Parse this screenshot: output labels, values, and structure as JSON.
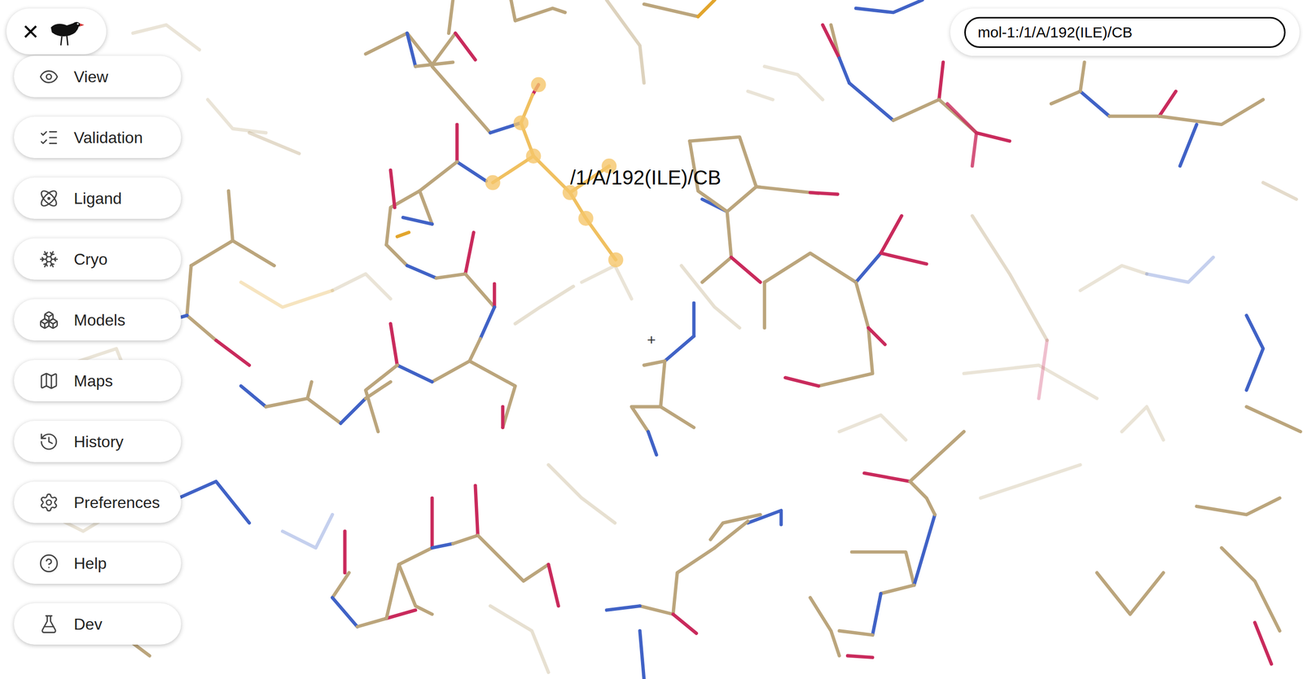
{
  "top_bar": {
    "close": "×"
  },
  "menu": [
    {
      "label": "View"
    },
    {
      "label": "Validation"
    },
    {
      "label": "Ligand"
    },
    {
      "label": "Cryo"
    },
    {
      "label": "Models"
    },
    {
      "label": "Maps"
    },
    {
      "label": "History"
    },
    {
      "label": "Preferences"
    },
    {
      "label": "Help"
    },
    {
      "label": "Dev"
    }
  ],
  "search": {
    "value": "mol-1:/1/A/192(ILE)/CB"
  },
  "viewer": {
    "atom_label": "/1/A/192(ILE)/CB",
    "cursor": "+"
  }
}
